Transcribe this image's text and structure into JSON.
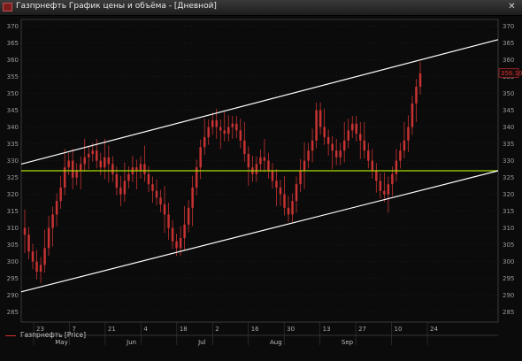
{
  "window": {
    "title": "Газпрнефть График цены и объёма - [Дневной]",
    "close_glyph": "✕"
  },
  "legend": {
    "label": "Газпрнефть [Price]",
    "color": "#c83232"
  },
  "colors": {
    "background": "#0b0b0b",
    "candle": "#c83232",
    "channel": "#ffffff",
    "level": "#a8e000",
    "last_price": "#d03030",
    "grid": "#2a2a2a"
  },
  "chart_data": {
    "type": "candlestick",
    "y_ticks": [
      285,
      290,
      295,
      300,
      305,
      310,
      315,
      320,
      325,
      330,
      335,
      340,
      345,
      350,
      355,
      360,
      365,
      370
    ],
    "ylim": [
      282,
      372
    ],
    "last_price_label": "356.10",
    "horizontal_level": 327,
    "channel_upper": {
      "start": 329,
      "end": 366
    },
    "channel_lower": {
      "start": 291,
      "end": 327
    },
    "x_ticks": [
      "23",
      "7",
      "21",
      "4",
      "18",
      "2",
      "16",
      "30",
      "13",
      "27",
      "10",
      "24"
    ],
    "months": [
      "May",
      "Jun",
      "Jul",
      "Aug",
      "Sep"
    ],
    "closes": [
      308,
      303,
      300,
      297,
      299,
      304,
      310,
      314,
      318,
      322,
      328,
      330,
      325,
      327,
      329,
      331,
      332,
      333,
      330,
      328,
      331,
      329,
      326,
      322,
      320,
      324,
      326,
      328,
      327,
      329,
      326,
      323,
      321,
      319,
      317,
      314,
      310,
      306,
      304,
      307,
      311,
      316,
      322,
      328,
      334,
      337,
      340,
      342,
      340,
      339,
      338,
      340,
      341,
      339,
      336,
      332,
      328,
      326,
      329,
      331,
      330,
      327,
      324,
      322,
      320,
      316,
      314,
      318,
      323,
      327,
      330,
      333,
      336,
      345,
      340,
      337,
      335,
      333,
      331,
      333,
      336,
      339,
      341,
      338,
      336,
      333,
      330,
      327,
      324,
      321,
      320,
      323,
      326,
      330,
      333,
      336,
      340,
      347,
      352,
      356
    ]
  }
}
